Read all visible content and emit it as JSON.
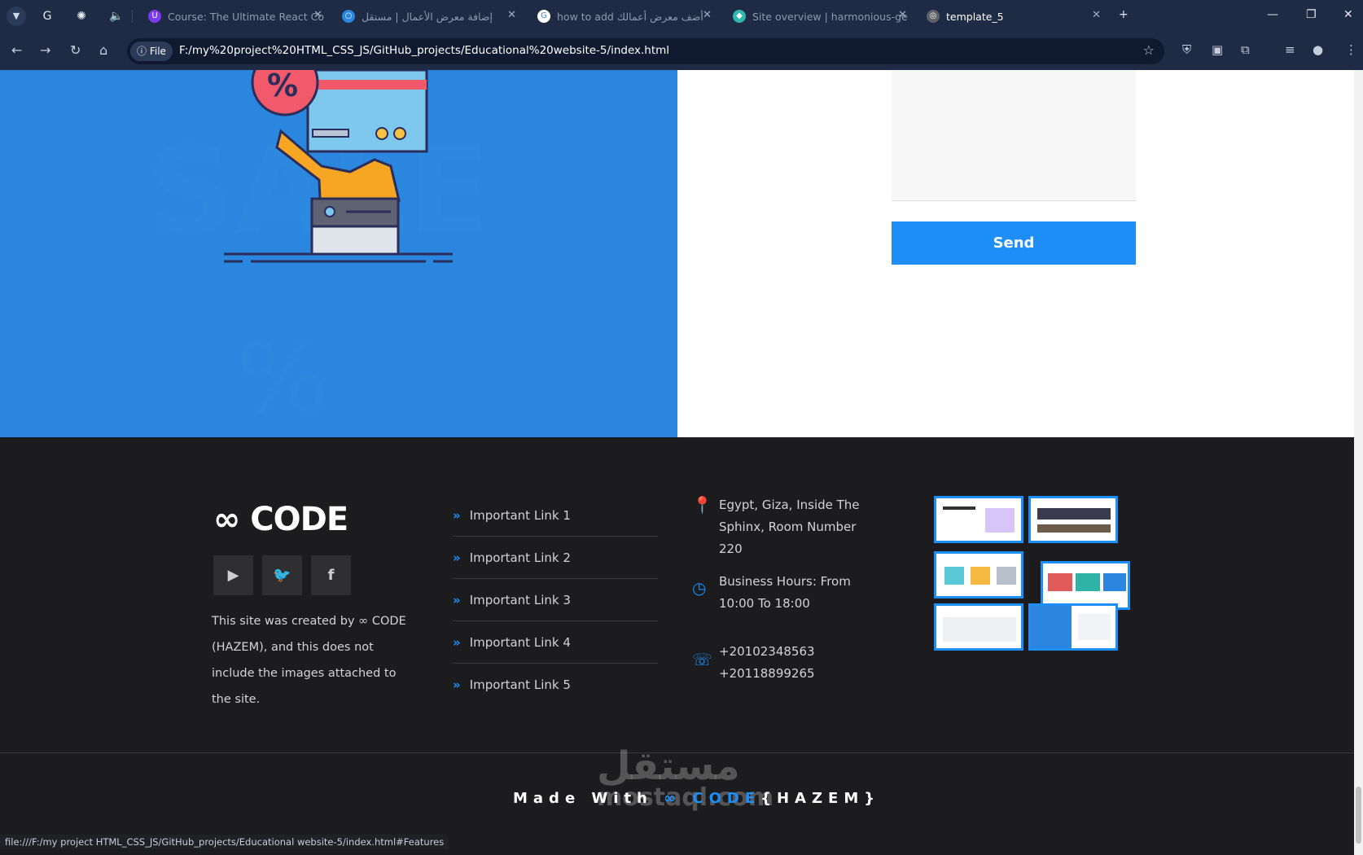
{
  "browser": {
    "tabs": [
      {
        "title": "Course: The Ultimate React Co",
        "active": false
      },
      {
        "title": "إضافة معرض الأعمال | مستقل",
        "active": false
      },
      {
        "title": "how to add أضف معرض أعمالك",
        "active": false
      },
      {
        "title": "Site overview | harmonious-ge",
        "active": false
      },
      {
        "title": "template_5",
        "active": true
      }
    ],
    "new_tab_label": "+",
    "scheme_label": "File",
    "url": "F:/my%20project%20HTML_CSS_JS/GitHub_projects/Educational%20website-5/index.html",
    "status_url": "file:///F:/my project HTML_CSS_JS/GitHub_projects/Educational website-5/index.html#Features"
  },
  "form": {
    "send_label": "Send"
  },
  "footer": {
    "logo_text": "CODE",
    "about_text": "This site was created by ∞ CODE (HAZEM), and this does not include the images attached to the site.",
    "links": [
      "Important Link 1",
      "Important Link 2",
      "Important Link 3",
      "Important Link 4",
      "Important Link 5"
    ],
    "address": "Egypt, Giza, Inside The Sphinx, Room Number 220",
    "hours": "Business Hours: From 10:00 To 18:00",
    "phone1": "+20102348563",
    "phone2": "+20118899265",
    "made_prefix": "Made With",
    "made_brand": "∞ CODE",
    "made_suffix": "{HAZEM}"
  },
  "watermark": {
    "arabic": "مستقل",
    "latin": "mostaql.com"
  },
  "colors": {
    "accent": "#1c8ef6",
    "hero_blue": "#2a86de",
    "footer_bg": "#1c1c1e",
    "chrome": "#1f2b45"
  }
}
